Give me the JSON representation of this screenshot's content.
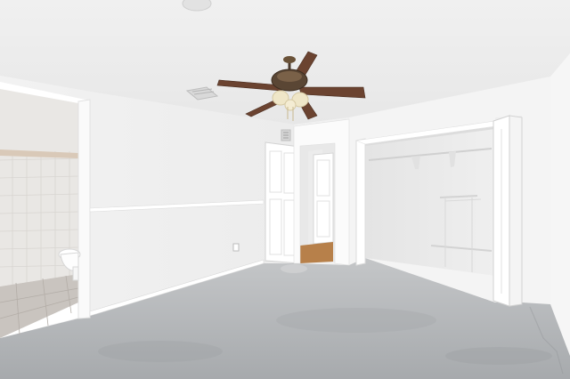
{
  "scene": {
    "kind": "empty-bedroom-photo",
    "colors": {
      "ceiling": "#f1f1f1",
      "wall_left": "#f5f5f5",
      "wall_back": "#f3f3f3",
      "wall_right": "#f7f7f7",
      "floor_concrete": "#b9bbbd",
      "bathroom_tile": "#e9e7e4",
      "bathroom_floor": "#c9c4bf",
      "wood_floor": "#b7804a",
      "fan_blade": "#6b4330",
      "fan_metal": "#4b3a2c",
      "fan_glass": "#efe6c8",
      "trim": "#ffffff"
    },
    "objects": [
      "ceiling-light",
      "ceiling-fan",
      "ceiling-vent",
      "bathroom-doorway",
      "toilet",
      "chair-rail",
      "interior-door",
      "hallway-door",
      "wall-vent",
      "closet",
      "closet-rod",
      "closet-shelf",
      "bifold-closet-door",
      "outlet",
      "concrete-floor"
    ]
  }
}
